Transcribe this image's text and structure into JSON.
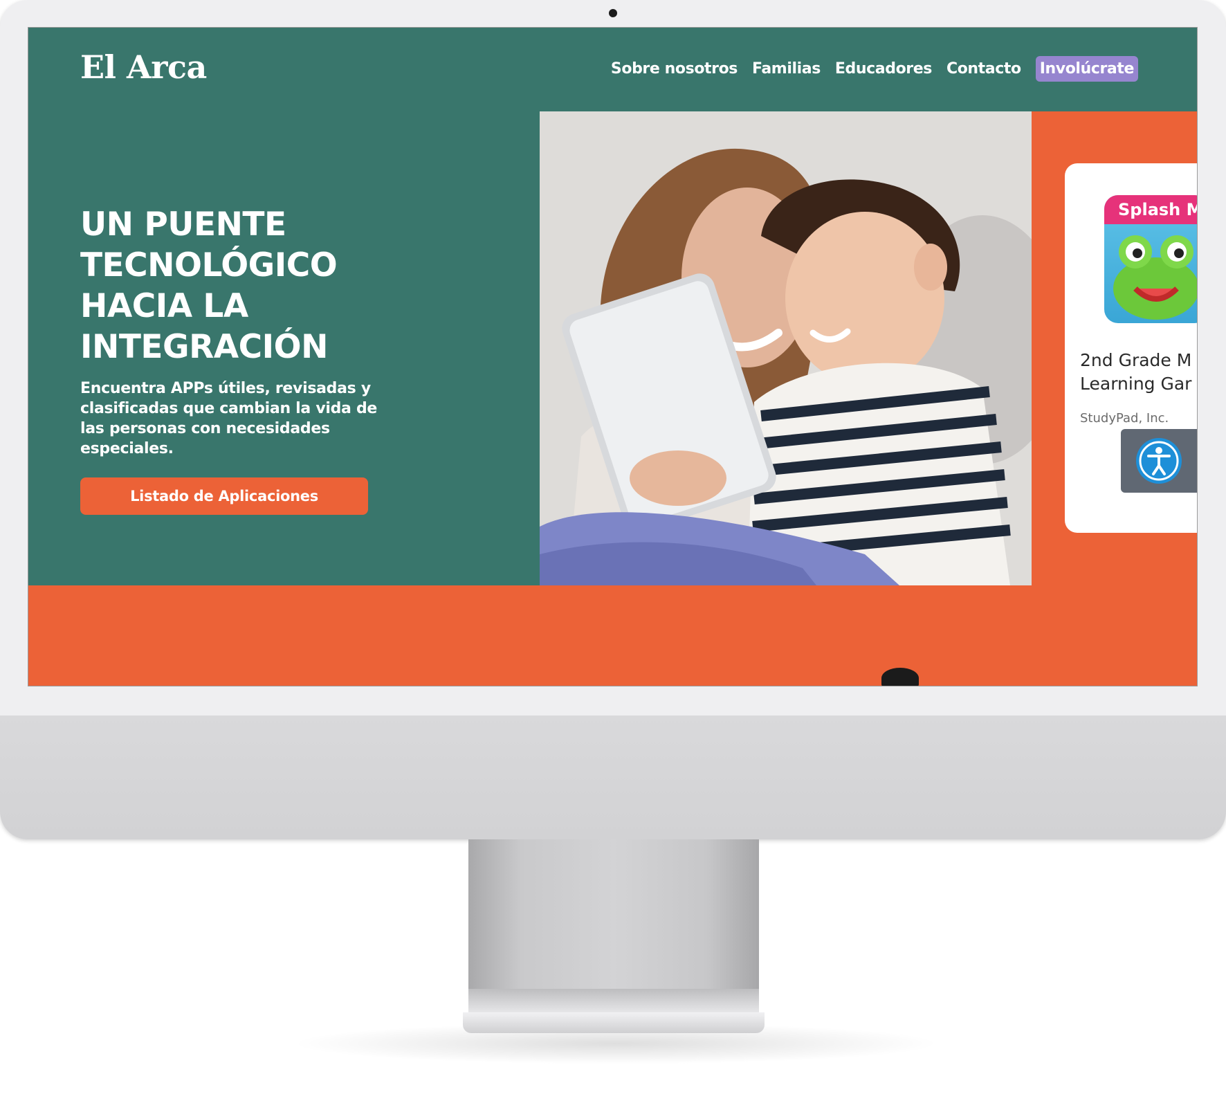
{
  "site": {
    "logo": "El Arca",
    "nav": {
      "links": [
        "Sobre nosotros",
        "Familias",
        "Educadores",
        "Contacto"
      ],
      "cta": "Involúcrate"
    }
  },
  "hero": {
    "title_lines": [
      "UN PUENTE",
      "TECNOLÓGICO",
      "HACIA LA",
      "INTEGRACIÓN"
    ],
    "subtitle": "Encuentra APPs útiles, revisadas y clasificadas que cambian la vida de las personas con necesidades especiales.",
    "button": "Listado de Aplicaciones"
  },
  "app_card": {
    "icon_label": "Splash M",
    "name_lines": [
      "2nd Grade M",
      "Learning Gar"
    ],
    "developer": "StudyPad, Inc."
  },
  "colors": {
    "green": "#39766c",
    "orange": "#ec6237",
    "purple": "#9685cf",
    "a11y_gray": "#606873",
    "a11y_blue": "#1e8fd8"
  },
  "icons": {
    "accessibility": "accessibility-person-icon"
  }
}
